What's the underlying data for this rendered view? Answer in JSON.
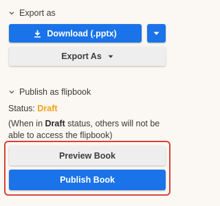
{
  "export_section": {
    "header": "Export as",
    "download_button": "Download (.pptx)",
    "export_as_button": "Export As"
  },
  "flipbook_section": {
    "header": "Publish as flipbook",
    "status_label": "Status:",
    "status_value": "Draft",
    "note_prefix": "(When in ",
    "note_bold": "Draft",
    "note_suffix": " status, others will not be able to access the flipbook)",
    "preview_button": "Preview Book",
    "publish_button": "Publish Book"
  },
  "colors": {
    "primary": "#1a73e8",
    "status_draft": "#f0a31a",
    "highlight_border": "#d9403a",
    "background": "#fbf7f2"
  }
}
